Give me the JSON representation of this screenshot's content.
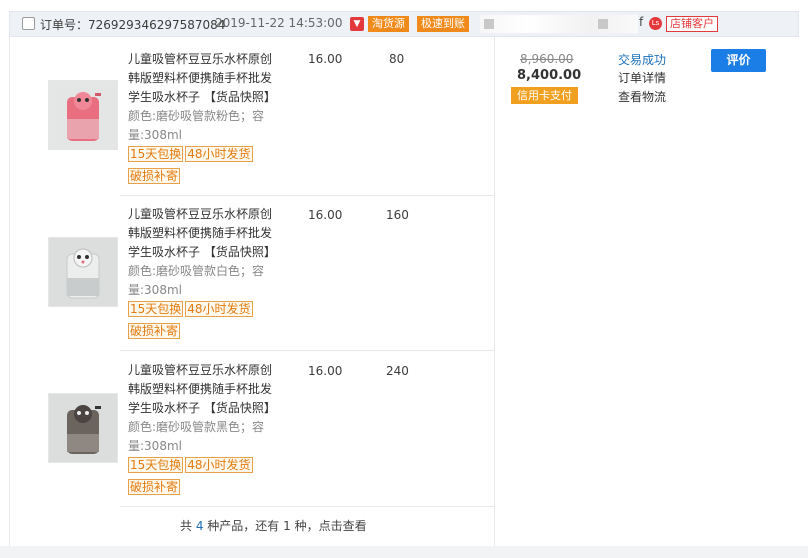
{
  "order": {
    "label": "订单号：726929346297587084",
    "time": "2019-11-22 14:53:00",
    "icon": "tmall-shop-icon",
    "badges": [
      "淘货源",
      "极速到账"
    ],
    "seller_suffix": "f",
    "seller_icon": "Ls",
    "customer_badge": "店铺客户"
  },
  "items": [
    {
      "name": "儿童吸管杯豆豆乐水杯原创韩版塑料杯便携随手杯批发学生吸水杯子 【货品快照】",
      "attr": "颜色:磨砂吸管款粉色；容量:308ml",
      "price": "16.00",
      "qty": "80",
      "tags": [
        "15天包换",
        "48小时发货",
        "破损补寄"
      ],
      "color": "#e96f80"
    },
    {
      "name": "儿童吸管杯豆豆乐水杯原创韩版塑料杯便携随手杯批发学生吸水杯子 【货品快照】",
      "attr": "颜色:磨砂吸管款白色；容量:308ml",
      "price": "16.00",
      "qty": "160",
      "tags": [
        "15天包换",
        "48小时发货",
        "破损补寄"
      ],
      "color": "#e6e8e8"
    },
    {
      "name": "儿童吸管杯豆豆乐水杯原创韩版塑料杯便携随手杯批发学生吸水杯子 【货品快照】",
      "attr": "颜色:磨砂吸管款黑色；容量:308ml",
      "price": "16.00",
      "qty": "240",
      "tags": [
        "15天包换",
        "48小时发货",
        "破损补寄"
      ],
      "color": "#5e5854"
    }
  ],
  "payment": {
    "original": "8,960.00",
    "paid": "8,400.00",
    "method": "信用卡支付"
  },
  "status": {
    "text": "交易成功",
    "detail_link": "订单详情",
    "logistics_link": "查看物流"
  },
  "actions": {
    "rate": "评价"
  },
  "footer": {
    "p1": "共 ",
    "num1": "4",
    "p2": " 种产品，还有 ",
    "num2": "1",
    "p3": " 种，点击查看"
  }
}
